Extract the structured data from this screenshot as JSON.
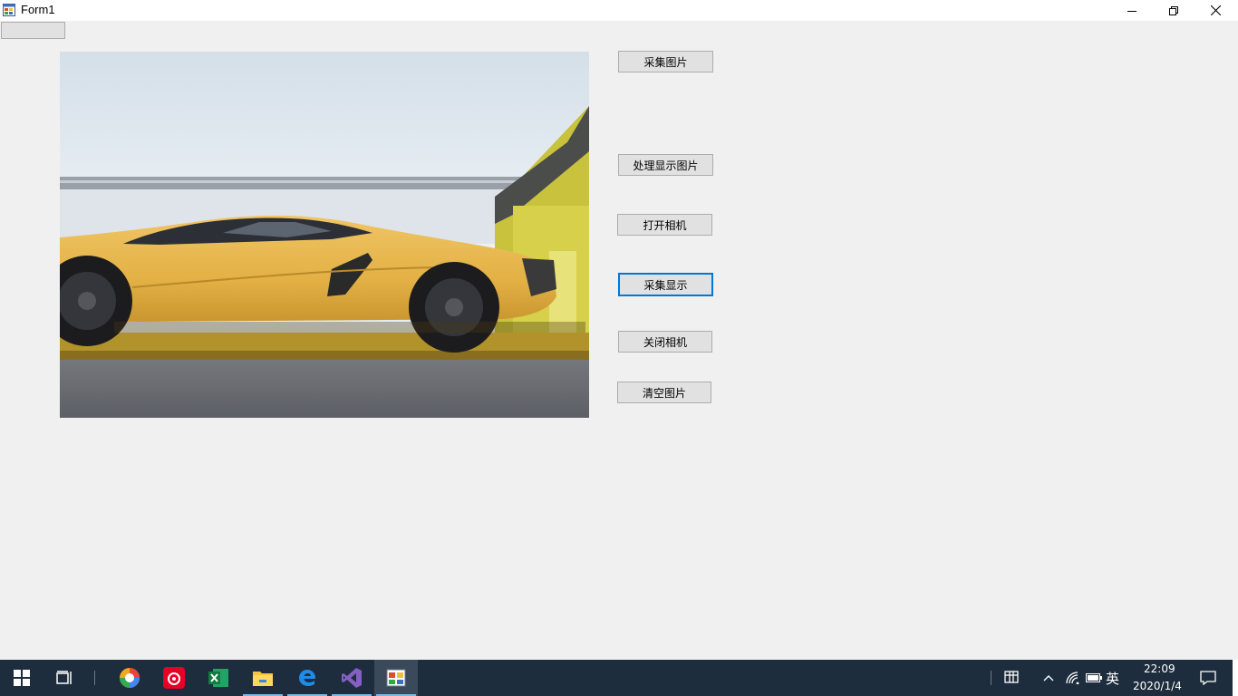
{
  "window": {
    "title": "Form1"
  },
  "buttons": {
    "capture_image": "采集图片",
    "process_display_image": "处理显示图片",
    "open_camera": "打开相机",
    "capture_display": "采集显示",
    "close_camera": "关闭相机",
    "clear_image": "清空图片",
    "small_top_left": ""
  },
  "taskbar": {
    "apps": [
      "start-icon",
      "task-view-icon",
      "browser-icon",
      "netease-music-icon",
      "excel-icon",
      "file-explorer-icon",
      "edge-icon",
      "visual-studio-icon",
      "winform-app-icon"
    ],
    "tray": {
      "ime_mode": "英",
      "time": "22:09",
      "date": "2020/1/4"
    }
  },
  "colors": {
    "accent": "#0078d7",
    "taskbar": "#1e2d3d",
    "form_bg": "#f0f0f0",
    "car": "#e8b94a"
  }
}
